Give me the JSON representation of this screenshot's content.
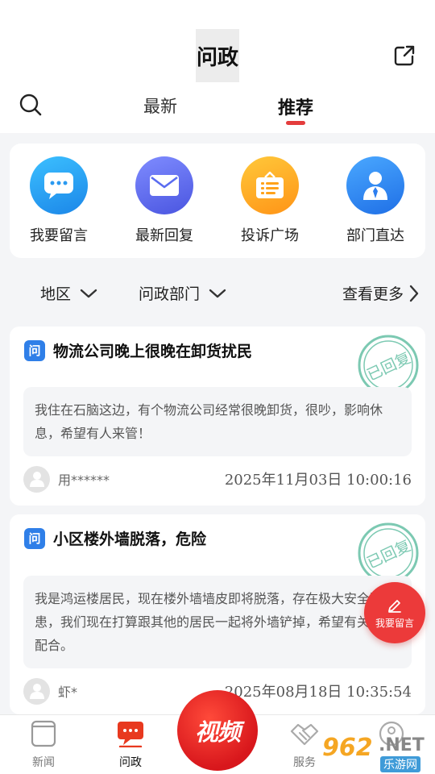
{
  "header": {
    "title": "问政",
    "tabs": [
      {
        "label": "最新"
      },
      {
        "label": "推荐"
      }
    ]
  },
  "quick_actions": [
    {
      "label": "我要留言",
      "icon": "message-bubble-icon",
      "color": "#2b9af0"
    },
    {
      "label": "最新回复",
      "icon": "envelope-icon",
      "color": "#5a6cf0"
    },
    {
      "label": "投诉广场",
      "icon": "board-list-icon",
      "color": "#ffa21a"
    },
    {
      "label": "部门直达",
      "icon": "person-icon",
      "color": "#2c7ef0"
    }
  ],
  "filters": {
    "region": "地区",
    "department": "问政部门",
    "more": "查看更多"
  },
  "posts": [
    {
      "badge": "问",
      "title": "物流公司晚上很晚在卸货扰民",
      "body": "我住在石脑这边，有个物流公司经常很晚卸货，很吵，影响休息，希望有人来管！",
      "user": "用******",
      "time": "2025年11月03日 10:00:16",
      "stamp": "已回复"
    },
    {
      "badge": "问",
      "title": "小区楼外墙脱落，危险",
      "body": "我是鸿运楼居民，现在楼外墙墙皮即将脱落，存在极大安全隐患，我们现在打算跟其他的居民一起将外墙铲掉，希望有关部门配合。",
      "user": "虾*",
      "time": "2025年08月18日 10:35:54",
      "stamp": "已回复"
    }
  ],
  "fab": {
    "label": "我要留言"
  },
  "bottom_nav": [
    {
      "label": "新闻"
    },
    {
      "label": "问政"
    },
    {
      "label": "视频"
    },
    {
      "label": "服务"
    }
  ],
  "watermark": {
    "number": "962",
    "net": ".NET",
    "cn": "乐游网"
  },
  "colors": {
    "accent": "#e43c3c",
    "stamp": "#7cc9b2"
  }
}
